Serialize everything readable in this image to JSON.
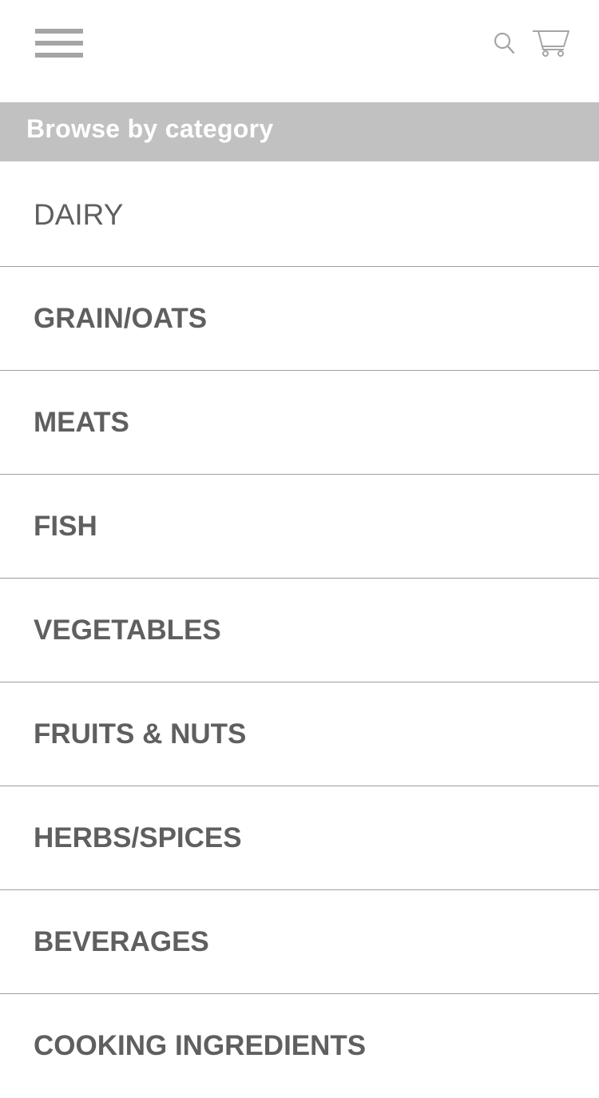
{
  "header": {
    "menu_icon": "hamburger-menu-icon",
    "search_icon": "search-icon",
    "cart_icon": "shopping-cart-icon",
    "icon_color": "#a5a5a5"
  },
  "banner": {
    "title": "Browse by category",
    "background": "#c1c1c1",
    "text_color": "#ffffff"
  },
  "categories": [
    {
      "label": "DAIRY"
    },
    {
      "label": "GRAIN/OATS"
    },
    {
      "label": "MEATS"
    },
    {
      "label": "FISH"
    },
    {
      "label": "VEGETABLES"
    },
    {
      "label": "FRUITS & NUTS"
    },
    {
      "label": "HERBS/SPICES"
    },
    {
      "label": "BEVERAGES"
    },
    {
      "label": "COOKING INGREDIENTS"
    }
  ]
}
